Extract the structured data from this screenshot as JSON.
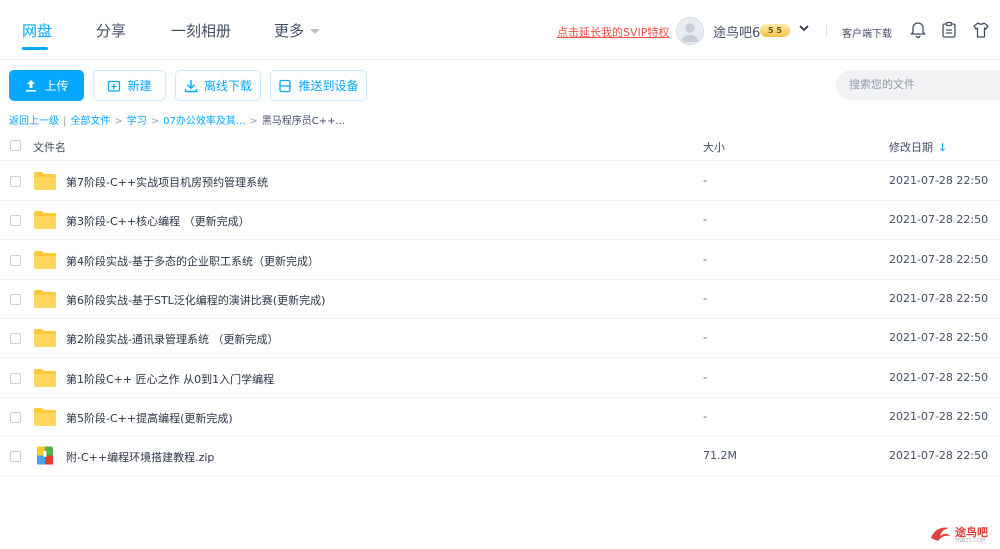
{
  "nav": {
    "tabs": [
      {
        "label": "网盘",
        "active": true
      },
      {
        "label": "分享",
        "active": false
      },
      {
        "label": "一刻相册",
        "active": false
      },
      {
        "label": "更多",
        "active": false
      }
    ],
    "svip_link": "点击延长我的SVIP特权",
    "username": "途鸟吧6",
    "vip_level": "5 5",
    "client_download": "客户端下载",
    "icons": [
      "user-avatar",
      "chevron-down-icon",
      "bell-icon",
      "clipboard-icon",
      "shirt-icon"
    ]
  },
  "toolbar": {
    "upload": "上传",
    "new": "新建",
    "offline_download": "离线下载",
    "push_device": "推送到设备",
    "search_placeholder": "搜索您的文件"
  },
  "breadcrumb": {
    "back": "返回上一级",
    "items": [
      "全部文件",
      "学习",
      "07办公效率及其...",
      "黑马程序员C++..."
    ]
  },
  "table": {
    "headers": {
      "name": "文件名",
      "size": "大小",
      "date": "修改日期"
    },
    "sort_arrow": "↓",
    "rows": [
      {
        "name": "第7阶段-C++实战项目机房预约管理系统",
        "size": "-",
        "date": "2021-07-28 22:50",
        "type": "folder"
      },
      {
        "name": "第3阶段-C++核心编程 （更新完成）",
        "size": "-",
        "date": "2021-07-28 22:50",
        "type": "folder"
      },
      {
        "name": "第4阶段实战-基于多态的企业职工系统（更新完成）",
        "size": "-",
        "date": "2021-07-28 22:50",
        "type": "folder"
      },
      {
        "name": "第6阶段实战-基于STL泛化编程的演讲比赛(更新完成)",
        "size": "-",
        "date": "2021-07-28 22:50",
        "type": "folder"
      },
      {
        "name": "第2阶段实战-通讯录管理系统 （更新完成）",
        "size": "-",
        "date": "2021-07-28 22:50",
        "type": "folder"
      },
      {
        "name": "第1阶段C++ 匠心之作 从0到1入门学编程",
        "size": "-",
        "date": "2021-07-28 22:50",
        "type": "folder"
      },
      {
        "name": "第5阶段-C++提高编程(更新完成)",
        "size": "-",
        "date": "2021-07-28 22:50",
        "type": "folder"
      },
      {
        "name": "附-C++编程环境搭建教程.zip",
        "size": "71.2M",
        "date": "2021-07-28 22:50",
        "type": "zip"
      }
    ]
  },
  "watermark": {
    "text": "途鸟吧",
    "sub": "TNBZS.COM"
  },
  "colors": {
    "accent": "#06a7ff",
    "folder": "#ffc83d",
    "svip": "#f04e42"
  }
}
